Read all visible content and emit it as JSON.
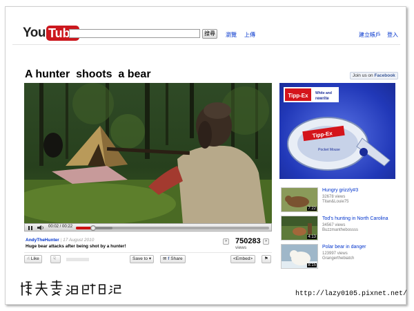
{
  "header": {
    "logo_you": "You",
    "logo_tube": "Tube",
    "search_placeholder": "",
    "search_button": "搜尋",
    "nav_browse": "瀏覽",
    "nav_upload": "上傳",
    "nav_create_account": "建立帳戶",
    "nav_login": "登入"
  },
  "video": {
    "title": "A hunter  shoots  a bear",
    "facebook_prefix": "Join us on ",
    "facebook_brand": "Facebook",
    "time_current": "00:02",
    "time_total": "00:22",
    "time_display": "00:02 / 00:22",
    "progress_fraction": 0.09,
    "buffered_fraction": 0.19,
    "uploader": "AndyTheHunter",
    "separator": "|",
    "upload_date": "17 August 2010",
    "description": "Huge bear attacks after being shot by a hunter!",
    "view_count": "750283",
    "views_label": "views",
    "expand_symbol": "»"
  },
  "actions": {
    "like": "Like",
    "save_to": "Save to",
    "share": "Share",
    "embed": "<Embed>"
  },
  "ad": {
    "brand": "Tipp-Ex",
    "tagline_1": "White and",
    "tagline_2": "rewrite",
    "product_brand": "Tipp-Ex",
    "product_name": "Pocket Mouse"
  },
  "related": [
    {
      "title": "Hungry grizzly#3",
      "views": "32678 views",
      "user": "Titan&Louie75",
      "duration": "7:22"
    },
    {
      "title": "Tod's hunting in North Carolina",
      "views": "34567 views",
      "user": "Buzzmanthebossss",
      "duration": "4:13"
    },
    {
      "title": "Polar bear in danger",
      "views": "123997 views",
      "user": "Grangerthebiatch",
      "duration": "8:15"
    }
  ],
  "watermark": {
    "url": "http://lazy0105.pixnet.net/",
    "signature": "懶夫妻過期日記"
  },
  "colors": {
    "youtube_red": "#cc181e",
    "link_blue": "#0033cc",
    "progress_red": "#cc1010",
    "ad_blue": "#2138b8"
  },
  "icons": [
    "search-icon",
    "play-pause-icon",
    "volume-icon",
    "thumb-up-icon",
    "thumb-down-icon",
    "email-icon",
    "facebook-icon",
    "flag-icon",
    "expand-icon"
  ]
}
